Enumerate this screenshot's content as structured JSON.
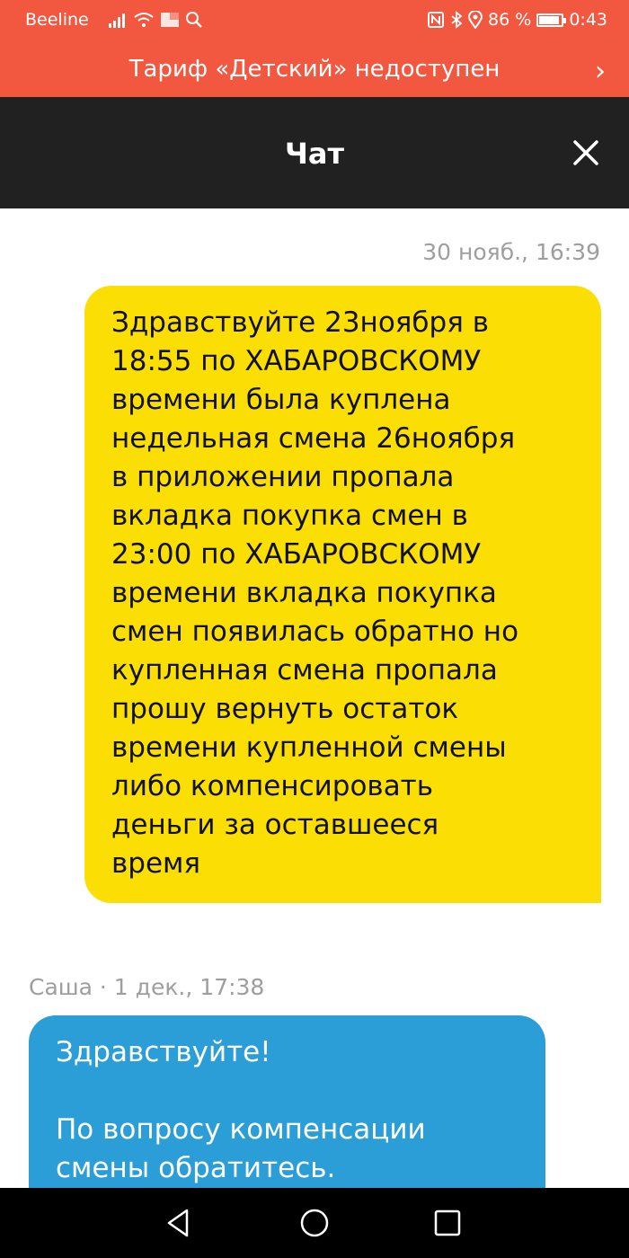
{
  "status_bar": {
    "carrier": "Beeline",
    "battery": "86 %",
    "time": "0:43"
  },
  "banner": {
    "text": "Тариф «Детский» недоступен",
    "chevron": "›"
  },
  "header": {
    "title": "Чат"
  },
  "messages": [
    {
      "timestamp": "30 нояб., 16:39",
      "direction": "outgoing",
      "text": "Здравствуйте 23ноября в\n18:55 по ХАБАРОВСКОМУ\nвремени была куплена\nнедельная смена 26ноября\nв приложении пропала\nвкладка покупка смен в\n23:00 по ХАБАРОВСКОМУ\nвремени вкладка покупка\nсмен появилась обратно но\nкупленная смена пропала\nпрошу вернуть остаток\nвремени купленной смены\nлибо компенсировать\nденьги за оставшееся\nвремя"
    },
    {
      "sender_timestamp": "Саша · 1 дек., 17:38",
      "direction": "incoming",
      "text": "Здравствуйте!\n\nПо вопросу компенсации\nсмены обратитесь."
    }
  ],
  "colors": {
    "banner_bg": "#f2573f",
    "header_bg": "#212121",
    "outgoing_bubble": "#fbde04",
    "incoming_bubble": "#2b9ed8"
  }
}
